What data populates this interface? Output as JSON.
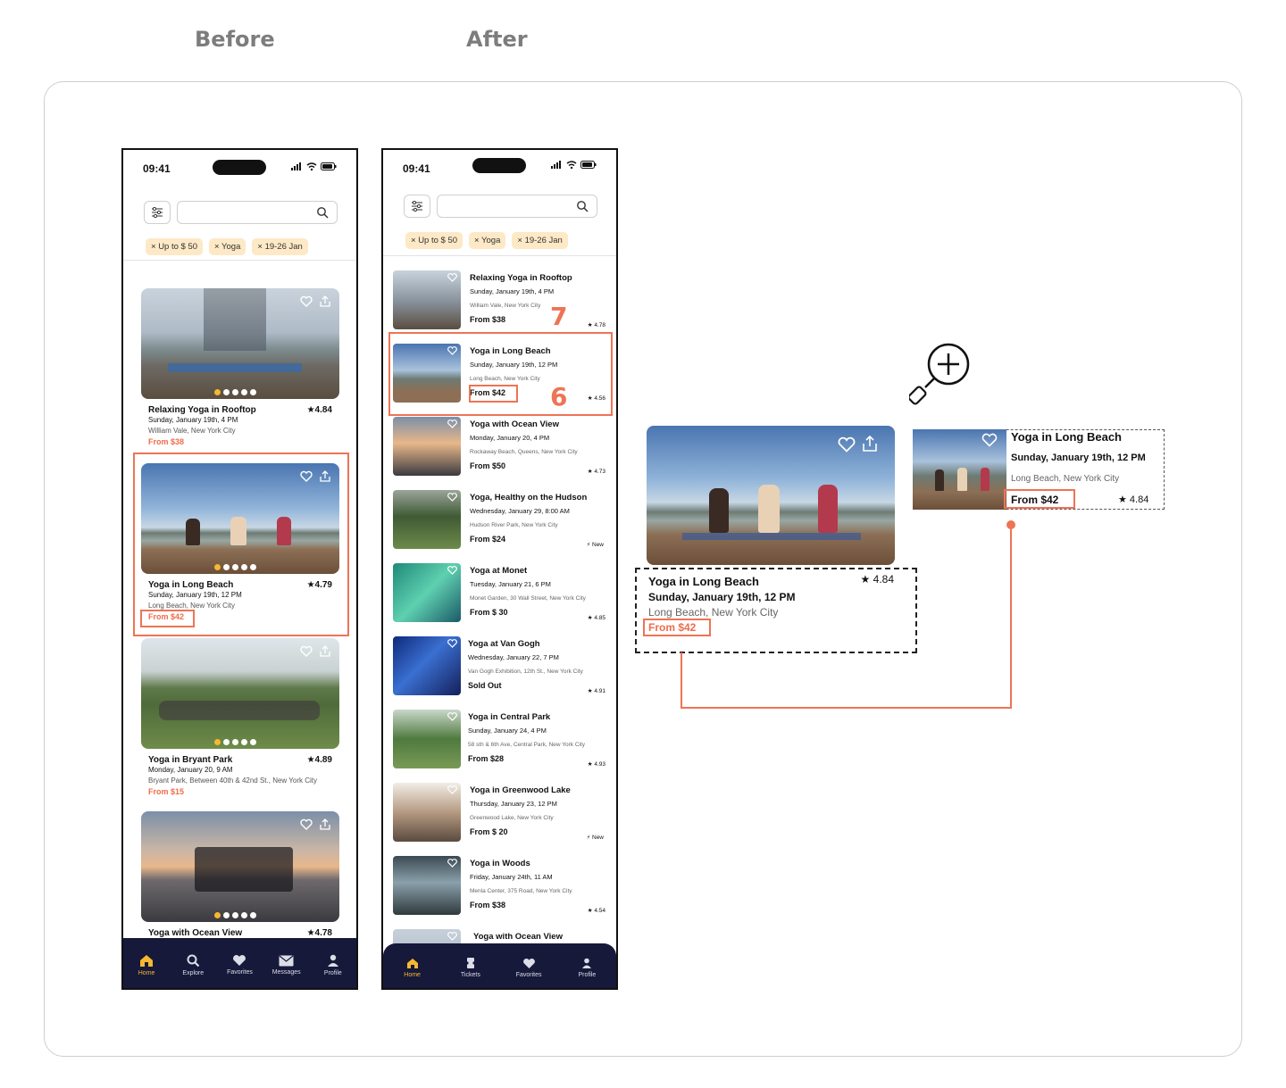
{
  "headings": {
    "before": "Before",
    "after": "After"
  },
  "status_time": "09:41",
  "filters": [
    "Up to $ 50",
    "Yoga",
    "19-26 Jan"
  ],
  "before": {
    "cards": [
      {
        "title": "Relaxing Yoga in Rooftop",
        "rating": "★4.84",
        "date": "Sunday, January 19th, 4 PM",
        "location": "William Vale, New York City",
        "price": "From $38"
      },
      {
        "title": "Yoga in Long Beach",
        "rating": "★4.79",
        "date": "Sunday, January 19th, 12 PM",
        "location": "Long Beach, New York City",
        "price": "From $42"
      },
      {
        "title": "Yoga in Bryant Park",
        "rating": "★4.89",
        "date": "Monday, January 20, 9 AM",
        "location": "Bryant Park, Between 40th & 42nd St., New York City",
        "price": "From $15"
      },
      {
        "title": "Yoga with Ocean View",
        "rating": "★4.78"
      }
    ],
    "tabs": [
      "Home",
      "Explore",
      "Favorites",
      "Messages",
      "Profile"
    ]
  },
  "after": {
    "rows": [
      {
        "title": "Relaxing Yoga in Rooftop",
        "date": "Sunday, January 19th, 4 PM",
        "location": "William Vale, New York City",
        "price": "From $38",
        "rating": "★ 4.78"
      },
      {
        "title": "Yoga in Long Beach",
        "date": "Sunday, January 19th, 12 PM",
        "location": "Long Beach, New York City",
        "price": "From $42",
        "rating": "★ 4.56"
      },
      {
        "title": "Yoga with Ocean View",
        "date": "Monday, January 20, 4 PM",
        "location": "Rockaway Beach, Queens, New York City",
        "price": "From $50",
        "rating": "★ 4.73"
      },
      {
        "title": "Yoga, Healthy on the Hudson",
        "date": "Wednesday, January 29,  8:00 AM",
        "location": "Hudson River Park, New York City",
        "price": "From $24",
        "rating": "⚡ New"
      },
      {
        "title": "Yoga at Monet",
        "date": "Tuesday, January 21, 6 PM",
        "location": "Monet Garden, 30 Wall Street, New York City",
        "price": "From $ 30",
        "rating": "★ 4.85"
      },
      {
        "title": "Yoga at Van Gogh",
        "date": "Wednesday, January 22, 7 PM",
        "location": "Van Gogh Exhibition, 12th St., New York City",
        "price": "Sold Out",
        "rating": "★ 4.91"
      },
      {
        "title": "Yoga in Central Park",
        "date": "Sunday, January 24, 4 PM",
        "location": "58 sth & 6th Ave, Central Park, New York City",
        "price": "From $28",
        "rating": "★ 4.93"
      },
      {
        "title": "Yoga in Greenwood Lake",
        "date": "Thursday, January 23, 12 PM",
        "location": "Greenwood Lake, New York City",
        "price": "From $ 20",
        "rating": "⚡ New"
      },
      {
        "title": "Yoga in Woods",
        "date": "Friday, January 24th, 11 AM",
        "location": "Menla Center, 375  Road, New York City",
        "price": "From $38",
        "rating": "★ 4.54"
      },
      {
        "title": "Yoga with Ocean View"
      }
    ],
    "annotations": [
      "7",
      "6"
    ],
    "tabs": [
      "Home",
      "Tickets",
      "Favorites",
      "Profile"
    ]
  },
  "zoom": {
    "large": {
      "title": "Yoga in Long Beach",
      "rating": "★ 4.84",
      "date": "Sunday, January 19th, 12 PM",
      "location": "Long Beach, New York City",
      "price": "From $42"
    },
    "small": {
      "title": "Yoga in Long Beach",
      "date": "Sunday, January 19th, 12 PM",
      "location": "Long Beach, New York City",
      "price": "From $42",
      "rating": "★ 4.84"
    }
  },
  "colors": {
    "accent": "#ee7455",
    "tab_active": "#f5b82e",
    "tabbar": "#16193a",
    "chip": "#fde9c6"
  }
}
